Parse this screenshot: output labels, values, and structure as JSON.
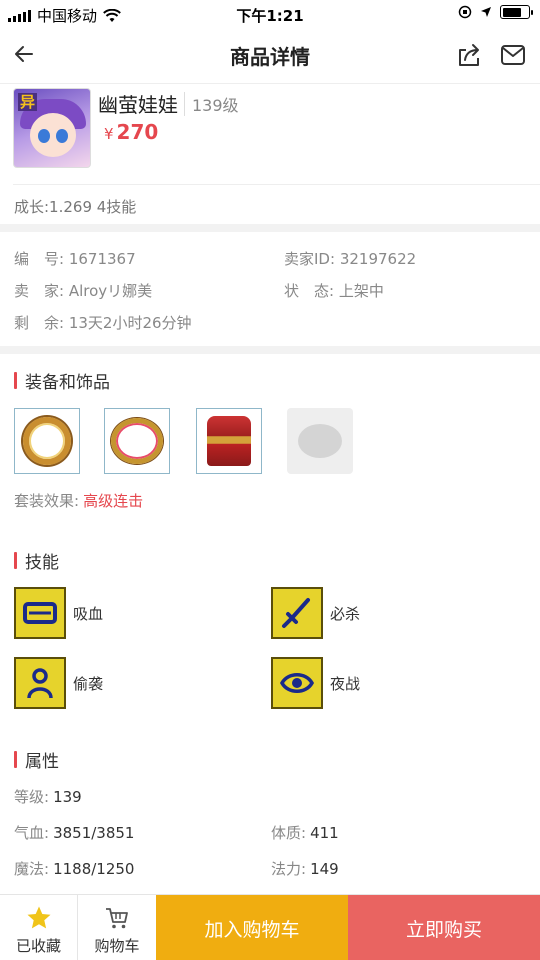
{
  "status_bar": {
    "carrier": "中国移动",
    "time": "下午1:21"
  },
  "nav": {
    "title": "商品详情"
  },
  "product": {
    "avatar_tag": "异",
    "name": "幽萤娃娃",
    "level": "139级",
    "price_symbol": "¥",
    "price": "270",
    "growth": "成长:1.269 4技能"
  },
  "info": {
    "number_label": "编　号:",
    "number": "1671367",
    "seller_id_label": "卖家ID:",
    "seller_id": "32197622",
    "seller_label": "卖　家:",
    "seller": "Alroyリ娜美",
    "status_label": "状　态:",
    "status": "上架中",
    "remaining_label": "剩　余:",
    "remaining": "13天2小时26分钟"
  },
  "equipment": {
    "title": "装备和饰品",
    "items": [
      {
        "icon": "ring-icon"
      },
      {
        "icon": "necklace-icon"
      },
      {
        "icon": "armor-icon"
      },
      {
        "icon": "empty-slot-icon"
      }
    ],
    "set_effect_label": "套装效果:",
    "set_effect_value": "高级连击"
  },
  "skills": {
    "title": "技能",
    "items": [
      {
        "label": "吸血",
        "icon": "drain-icon"
      },
      {
        "label": "必杀",
        "icon": "sword-icon"
      },
      {
        "label": "偷袭",
        "icon": "sneak-icon"
      },
      {
        "label": "夜战",
        "icon": "eye-icon"
      }
    ]
  },
  "attributes": {
    "title": "属性",
    "level_label": "等级:",
    "level": "139",
    "hp_label": "气血:",
    "hp": "3851/3851",
    "con_label": "体质:",
    "con": "411",
    "mp_label": "魔法:",
    "mp": "1188/1250",
    "mag_label": "法力:",
    "mag": "149"
  },
  "bottom": {
    "favorite_label": "已收藏",
    "cart_label": "购物车",
    "add_cart_label": "加入购物车",
    "buy_label": "立即购买"
  },
  "colors": {
    "accent_red": "#e5474e",
    "add_cart_bg": "#f0ad10",
    "buy_bg": "#e96461",
    "favorite_star": "#f0c419"
  }
}
